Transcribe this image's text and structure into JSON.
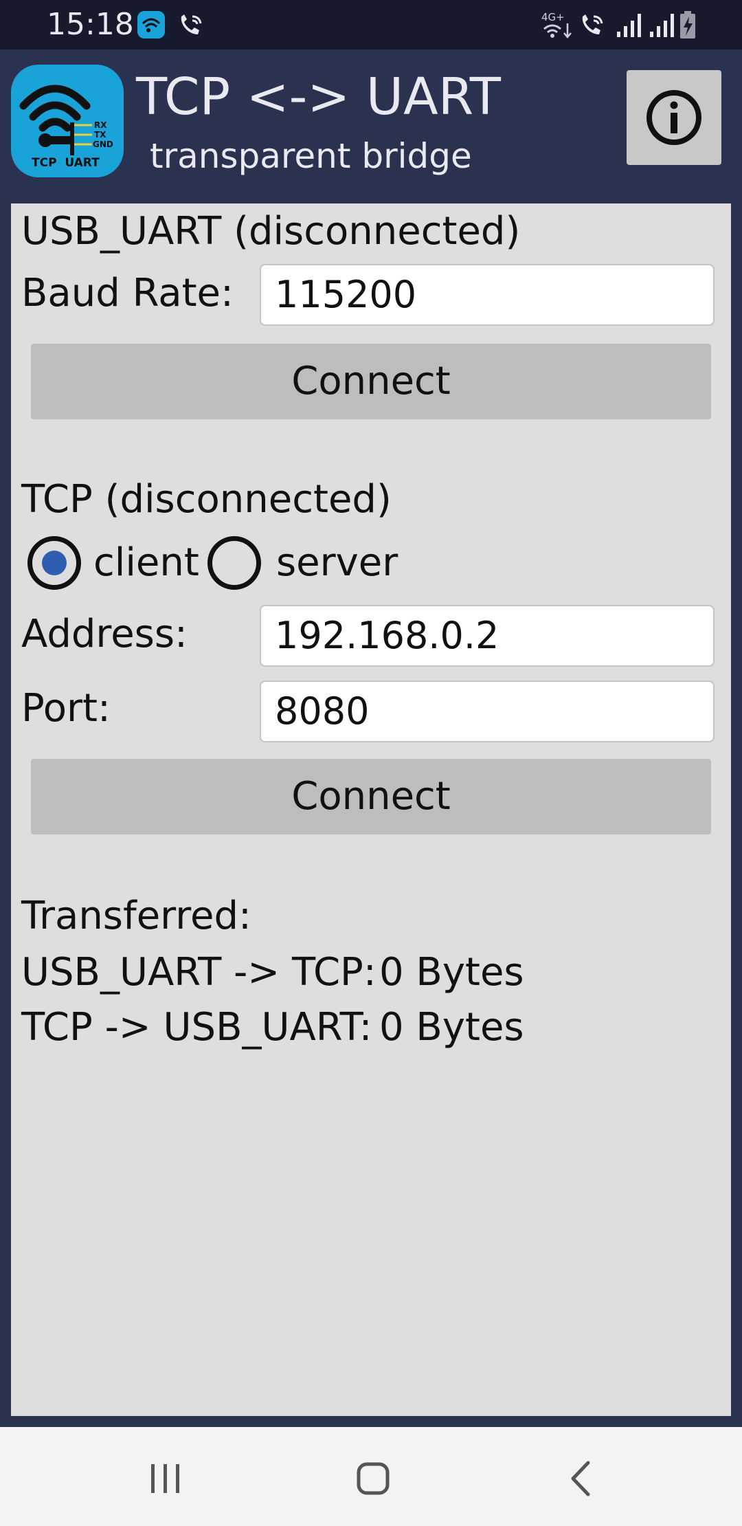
{
  "status_bar": {
    "time": "15:18",
    "left_icons": [
      "app-notification-icon",
      "wifi-calling-icon"
    ],
    "right_icons": [
      "4g-data-icon",
      "wifi-calling-icon",
      "signal-icon",
      "signal-icon",
      "battery-charging-icon"
    ],
    "network_label": "4G+"
  },
  "header": {
    "title": "TCP <-> UART",
    "subtitle": "transparent bridge",
    "logo": {
      "pins": [
        "RX",
        "TX",
        "GND"
      ],
      "caption": "TCP  UART"
    },
    "info_icon": "info-icon"
  },
  "uart": {
    "heading": "USB_UART (disconnected)",
    "baud_label": "Baud Rate:",
    "baud_value": "115200",
    "connect_label": "Connect"
  },
  "tcp": {
    "heading": "TCP (disconnected)",
    "mode_client": "client",
    "mode_server": "server",
    "selected_mode": "client",
    "address_label": "Address:",
    "address_value": "192.168.0.2",
    "port_label": "Port:",
    "port_value": "8080",
    "connect_label": "Connect"
  },
  "stats": {
    "heading": "Transferred:",
    "uart_to_tcp_label": "USB_UART -> TCP:",
    "uart_to_tcp_value": "0 Bytes",
    "tcp_to_uart_label": "TCP -> USB_UART:",
    "tcp_to_uart_value": "0 Bytes"
  },
  "nav_bar": {
    "icons": [
      "recent-apps-icon",
      "home-icon",
      "back-icon"
    ]
  },
  "colors": {
    "header_bg": "#2b3250",
    "status_bg": "#171a2c",
    "panel_bg": "#dedede",
    "button_bg": "#bdbdbd",
    "logo_bg": "#1aa3d9",
    "radio_selected": "#2f5eb0"
  }
}
